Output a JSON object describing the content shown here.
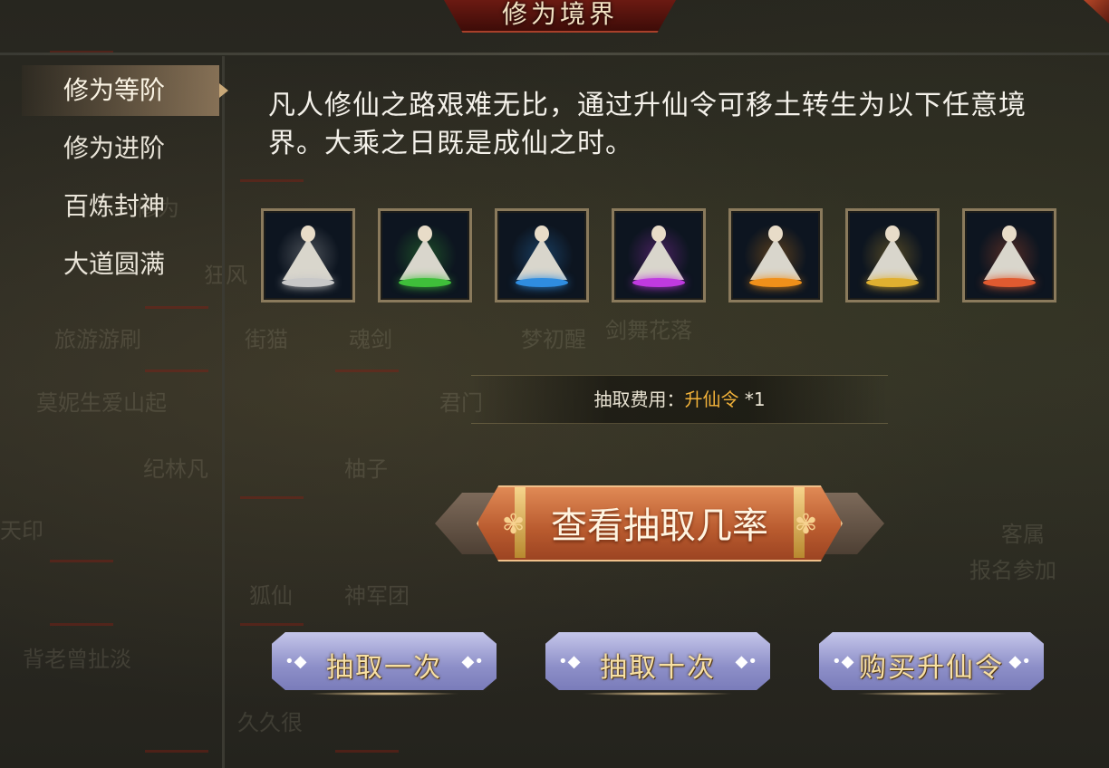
{
  "window": {
    "title": "修为境界"
  },
  "sidebar": {
    "items": [
      {
        "label": "修为等阶",
        "active": true
      },
      {
        "label": "修为进阶",
        "active": false
      },
      {
        "label": "百炼封神",
        "active": false
      },
      {
        "label": "大道圆满",
        "active": false
      }
    ]
  },
  "main": {
    "description": "凡人修仙之路艰难无比，通过升仙令可移土转生为以下任意境界。大乘之日既是成仙之时。",
    "avatars": [
      {
        "icon": "white-realm-avatar-icon",
        "color": "#c8c8c8"
      },
      {
        "icon": "green-realm-avatar-icon",
        "color": "#3fbf3a"
      },
      {
        "icon": "blue-realm-avatar-icon",
        "color": "#2f8de0"
      },
      {
        "icon": "purple-realm-avatar-icon",
        "color": "#c03ae0"
      },
      {
        "icon": "orange-realm-avatar-icon",
        "color": "#f0901a"
      },
      {
        "icon": "gold-blue-realm-avatar-icon",
        "color": "#e0b030"
      },
      {
        "icon": "red-realm-avatar-icon",
        "color": "#e05a30"
      }
    ],
    "cost": {
      "label": "抽取费用：",
      "item": "升仙令",
      "qty": "*1"
    },
    "probability_button": "查看抽取几率",
    "actions": {
      "draw_once": "抽取一次",
      "draw_ten": "抽取十次",
      "buy_token": "购买升仙令"
    }
  },
  "background_text": [
    "修为",
    "狂风",
    "旅游游刷",
    "街猫",
    "魂剑",
    "梦初醒",
    "剑舞花落",
    "莫妮生爱山起",
    "君门",
    "纪林凡",
    "柚子",
    "天印",
    "狐仙",
    "神军团",
    "背老曾扯淡",
    "久久很",
    "客属",
    "报名参加"
  ],
  "colors": {
    "accent": "#f2b23a",
    "title_banner": "#6b1a12",
    "button_violet": "#8d8fc8",
    "button_orange": "#c0622e"
  }
}
